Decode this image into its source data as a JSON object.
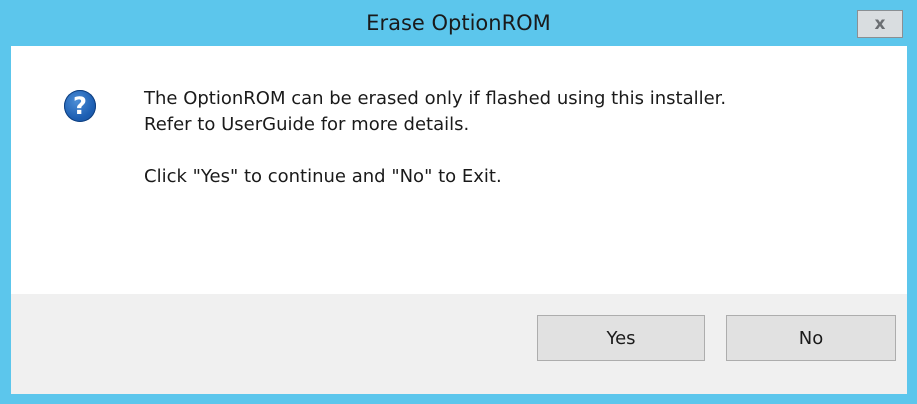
{
  "dialog": {
    "title": "Erase OptionROM",
    "close_glyph": "x",
    "icon": "question-icon",
    "icon_glyph": "?",
    "message": {
      "line1": "The OptionROM can be erased only if flashed using this installer.",
      "line2": "Refer to UserGuide for more details.",
      "line3": "Click \"Yes\" to continue and \"No\" to Exit."
    },
    "buttons": {
      "yes_label": "Yes",
      "no_label": "No"
    }
  },
  "colors": {
    "titlebar": "#5cc6ec",
    "icon": "#1d5fb3",
    "footer": "#f0f0f0"
  }
}
